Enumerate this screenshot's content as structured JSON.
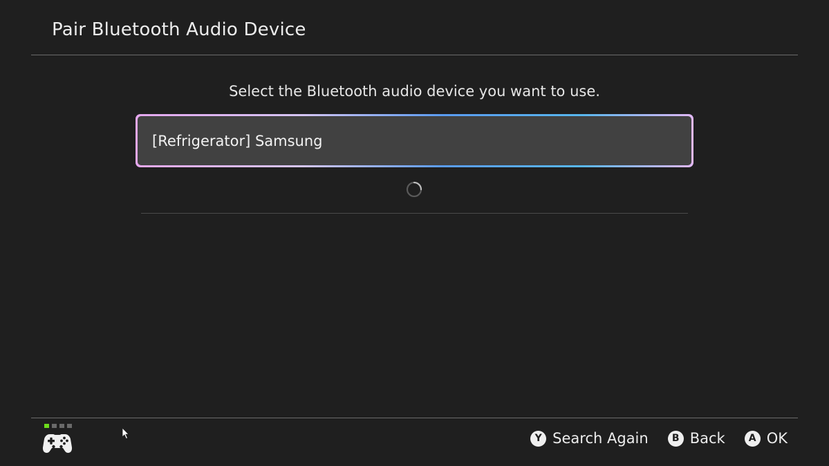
{
  "header": {
    "title": "Pair Bluetooth Audio Device"
  },
  "main": {
    "prompt": "Select the Bluetooth audio device you want to use.",
    "devices": [
      {
        "label": "[Refrigerator] Samsung",
        "selected": true
      }
    ],
    "loading": true
  },
  "footer": {
    "player_indicator": {
      "active_player": 1,
      "total": 4
    },
    "controller_icon": "controller-icon",
    "actions": [
      {
        "button": "Y",
        "label": "Search Again"
      },
      {
        "button": "B",
        "label": "Back"
      },
      {
        "button": "A",
        "label": "OK"
      }
    ]
  },
  "colors": {
    "background": "#1f1f1f",
    "item_background": "#414141",
    "active_player": "#6ddc1b",
    "focus_gradient": [
      "#e6a8f0",
      "#5a9cf2",
      "#58b8ef"
    ]
  }
}
